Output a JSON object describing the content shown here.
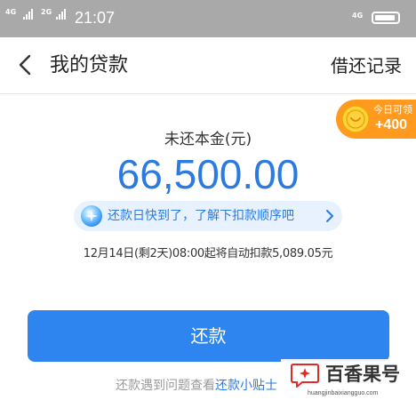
{
  "status_bar": {
    "network_1": "4G",
    "network_2": "2G",
    "time": "21:07",
    "network_right": "4G"
  },
  "header": {
    "title": "我的贷款",
    "action_label": "借还记录"
  },
  "reward_badge": {
    "label": "今日可领",
    "value": "+400"
  },
  "loan": {
    "principal_label": "未还本金(元)",
    "principal_amount": "66,500.00",
    "notice_text": "还款日快到了，了解下扣款顺序吧",
    "deduction_info": "12月14日(剩2天)08:00起将自动扣款5,089.05元"
  },
  "repay_button_label": "还款",
  "help": {
    "prefix": "还款遇到问题查看",
    "link": "还款小贴士"
  },
  "watermark": {
    "name": "百香果号",
    "url": "huangjinbaixiangguo.com"
  },
  "colors": {
    "accent": "#2a7ae2",
    "button": "#2f85f0",
    "badge": "#ff9a1f",
    "status_bar": "#a9a9a9"
  }
}
